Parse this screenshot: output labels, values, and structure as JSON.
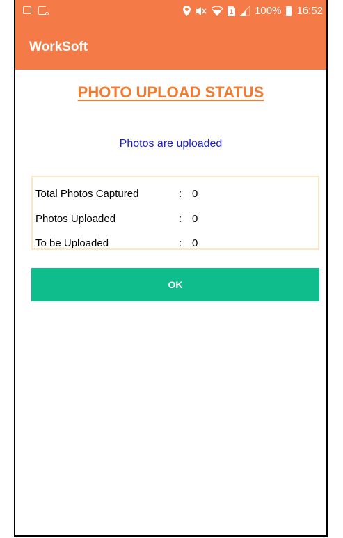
{
  "status_bar": {
    "battery": "100%",
    "time": "16:52",
    "icons": [
      "image-icon",
      "cast-icon",
      "location-icon",
      "mute-icon",
      "wifi-icon",
      "sim-icon",
      "signal-icon",
      "battery-icon"
    ]
  },
  "app_bar": {
    "title": "WorkSoft",
    "color": "#f47a48"
  },
  "heading": "PHOTO UPLOAD STATUS",
  "status_message": "Photos are uploaded",
  "stats": [
    {
      "label": "Total Photos Captured",
      "separator": ":",
      "value": "0"
    },
    {
      "label": "Photos Uploaded",
      "separator": ":",
      "value": "0"
    },
    {
      "label": "To be Uploaded",
      "separator": ":",
      "value": "0"
    }
  ],
  "ok_button": {
    "label": "OK",
    "color": "#0fbd8c"
  }
}
